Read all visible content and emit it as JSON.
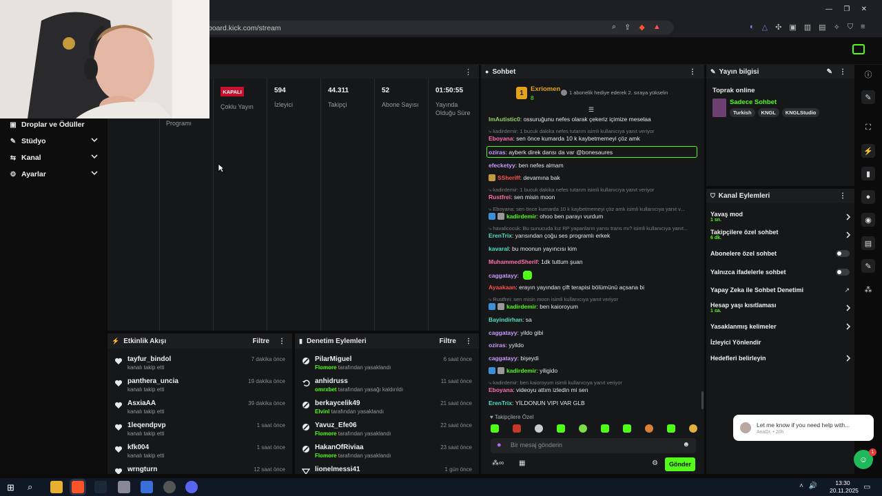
{
  "browser": {
    "url": "board.kick.com/stream",
    "window_controls": [
      "minimize-icon",
      "restore-icon",
      "close-icon"
    ]
  },
  "sidebar": {
    "items": [
      {
        "label": "Droplar ve Ödüller",
        "icon": "gift-icon",
        "expandable": false
      },
      {
        "label": "Stüdyo",
        "icon": "studio-icon",
        "expandable": true
      },
      {
        "label": "Kanal",
        "icon": "channel-icon",
        "expandable": true
      },
      {
        "label": "Ayarlar",
        "icon": "gear-icon",
        "expandable": true
      }
    ]
  },
  "stats": {
    "first_col_label": "Programı",
    "status_badge": "KAPALI",
    "multi_stream_label": "Çoklu Yayın",
    "viewers_value": "594",
    "viewers_label": "İzleyici",
    "followers_value": "44.311",
    "followers_label": "Takipçi",
    "subs_value": "52",
    "subs_label": "Abone Sayısı",
    "duration_value": "01:50:55",
    "duration_label_1": "Yayında",
    "duration_label_2": "Olduğu Süre"
  },
  "activity": {
    "title": "Etkinlik Akışı",
    "filter_label": "Filtre",
    "rows": [
      {
        "name": "tayfur_bindol",
        "sub": "kanalı takip etti",
        "time": "7 dakika önce"
      },
      {
        "name": "panthera_uncia",
        "sub": "kanalı takip etti",
        "time": "19 dakika önce"
      },
      {
        "name": "AsxiaAA",
        "sub": "kanalı takip etti",
        "time": "39 dakika önce"
      },
      {
        "name": "1leqendpvp",
        "sub": "kanalı takip etti",
        "time": "1 saat önce"
      },
      {
        "name": "kfk004",
        "sub": "kanalı takip etti",
        "time": "1 saat önce"
      },
      {
        "name": "wrngturn",
        "sub": "",
        "time": "12 saat önce"
      }
    ]
  },
  "moderation": {
    "title": "Denetim Eylemleri",
    "filter_label": "Filtre",
    "rows": [
      {
        "name": "PilarMiguel",
        "mod": "Flomore",
        "action": "tarafından yasaklandı",
        "time": "6 saat önce"
      },
      {
        "name": "anhidruss",
        "mod": "omrxbet",
        "action": "tarafından yasağı kaldırıldı",
        "time": "11 saat önce"
      },
      {
        "name": "berkaycelik49",
        "mod": "Elvinl",
        "action": "tarafından yasaklandı",
        "time": "21 saat önce"
      },
      {
        "name": "Yavuz_Efe06",
        "mod": "Flomore",
        "action": "tarafından yasaklandı",
        "time": "22 saat önce"
      },
      {
        "name": "HakanOfRiviaa",
        "mod": "Flomore",
        "action": "tarafından yasaklandı",
        "time": "23 saat önce"
      },
      {
        "name": "lionelmessi41",
        "mod": "",
        "action": "",
        "time": "1 gün önce"
      }
    ]
  },
  "chat": {
    "title": "Sohbet",
    "top_user": "Exriomen",
    "top_rank": "1",
    "top_count": "8",
    "gift_text": "1 abonelik hediye ederek 2. sıraya yükselin",
    "messages": [
      {
        "user": "ImAutistic0",
        "color": "#9bd16b",
        "text": "ossuruğunu nefes olarak çekeriz içimize meselaa"
      },
      {
        "reply": "kadirdemir: 1 bucuk dakika nefes tutarım isimli kullanıcıya yanıt veriyor"
      },
      {
        "user": "Eboyana",
        "color": "#ff6fb1",
        "text": "sen önce kumarda 10 k kaybetmemeyi çöz amk"
      },
      {
        "user": "oziras",
        "color": "#c89bff",
        "text": "ayberk direk dansı da var @bonesaures",
        "highlight": true
      },
      {
        "user": "efecketyy",
        "color": "#c89bff",
        "text": "ben nefes almam"
      },
      {
        "user": "SSheriff",
        "color": "#ff4f4f",
        "text": "devamına bak"
      },
      {
        "reply": "kadirdemir: 1 bucuk dakika nefes tutarım isimli kullanıcıya yanıt veriyor"
      },
      {
        "user": "Rustfrei",
        "color": "#ff6f9c",
        "text": "sen misin moon"
      },
      {
        "reply": "Eboyana: sen önce kumarda 10 k kaybetmemeyi çöz amk isimli kullanıcıya yanıt v..."
      },
      {
        "user": "kadirdemir",
        "color": "#53fc18",
        "text": "ohoo ben parayı vurdum"
      },
      {
        "reply": "havalicocuk: Bu sunucuda kız RP yapanların yarısı trans mı? isimli kullanıcıya yanıt..."
      },
      {
        "user": "ErenTrix",
        "color": "#4fe0c4",
        "text": "yarısından çoğu ses programlı erkek"
      },
      {
        "user": "kavaraI",
        "color": "#4fe0c4",
        "text": "bu moonun yayıncısı kim"
      },
      {
        "user": "MuhammedSherif",
        "color": "#ff6fb1",
        "text": "1dk tuttum şuan"
      },
      {
        "user": "caggatayy",
        "color": "#c89bff",
        "text": ""
      },
      {
        "user": "Ayaakaan",
        "color": "#ff4f4f",
        "text": "erayın yayından çift terapisi bölümünü açsana bi"
      },
      {
        "reply": "Rustfrei: sen misin moon isimli kullanıcıya yanıt veriyor"
      },
      {
        "user": "kadirdemir",
        "color": "#53fc18",
        "text": "ben kaioroyum"
      },
      {
        "user": "Bayindirhan",
        "color": "#4fe0c4",
        "text": "sa"
      },
      {
        "user": "caggatayy",
        "color": "#c89bff",
        "text": "yildo gibi"
      },
      {
        "user": "oziras",
        "color": "#c89bff",
        "text": "yyildo"
      },
      {
        "user": "caggatayy",
        "color": "#c89bff",
        "text": "bişeydi"
      },
      {
        "user": "kadirdemir",
        "color": "#53fc18",
        "text": "yiligido"
      },
      {
        "reply": "kadirdemir: ben kaioroyum isimli kullanıcıya yanıt veriyor"
      },
      {
        "user": "Eboyana",
        "color": "#ff6fb1",
        "text": "videoyu attım izledin mi sen"
      },
      {
        "user": "ErenTrix",
        "color": "#4fe0c4",
        "text": "YİLDONUN VIPI VAR GLB"
      }
    ],
    "emote_section": "Takipçilere Özel",
    "input_placeholder": "Bir mesaj gönderin",
    "send_label": "Gönder"
  },
  "stream_info": {
    "title": "Yayın bilgisi",
    "stream_title": "Toprak online",
    "category": "Sadece Sohbet",
    "tags": [
      "Turkish",
      "KNGL",
      "KNGLStudio"
    ]
  },
  "channel_actions": {
    "title": "Kanal Eylemleri",
    "items": [
      {
        "label": "Yavaş mod",
        "sub": "1 sn.",
        "control": "chevron"
      },
      {
        "label": "Takipçilere özel sohbet",
        "sub": "6 dk.",
        "control": "chevron"
      },
      {
        "label": "Abonelere özel sohbet",
        "sub": "",
        "control": "toggle"
      },
      {
        "label": "Yalnızca ifadelerle sohbet",
        "sub": "",
        "control": "toggle"
      },
      {
        "label": "Yapay Zeka ile Sohbet Denetimi",
        "sub": "",
        "control": "external"
      },
      {
        "label": "Hesap yaşı kısıtlaması",
        "sub": "1 sa.",
        "control": "chevron"
      },
      {
        "label": "Yasaklanmış kelimeler",
        "sub": "",
        "control": "chevron"
      },
      {
        "label": "İzleyici Yönlendir",
        "sub": "",
        "control": "none"
      },
      {
        "label": "Hedefleri belirleyin",
        "sub": "",
        "control": "chevron"
      }
    ]
  },
  "help_popup": {
    "text": "Let me know if you need help with...",
    "meta": "AnaDr. • 20h",
    "badge": "1"
  },
  "taskbar": {
    "time": "13:30",
    "date": "20.11.2025"
  },
  "colors": {
    "accent": "#53fc18",
    "live_badge": "#c8102e",
    "panel": "#161718",
    "background": "#0b0b0c"
  }
}
